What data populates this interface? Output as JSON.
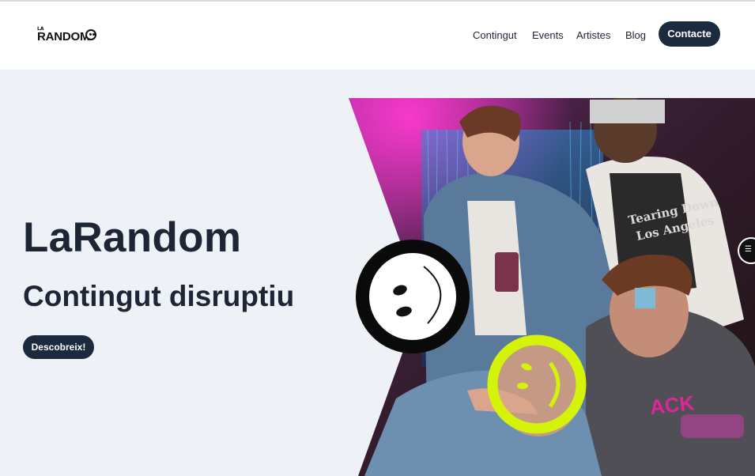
{
  "header": {
    "logo": {
      "small": "LA",
      "word": "RANDOM"
    },
    "nav": [
      "Contingut",
      "Events",
      "Artistes",
      "Blog"
    ],
    "contact_label": "Contacte"
  },
  "hero": {
    "title": "LaRandom",
    "subtitle": "Contingut disruptiu",
    "cta_label": "Descobreix!"
  },
  "photo": {
    "shirt_text_1": "Tearing Down",
    "shirt_text_2": "Los Angeles",
    "hoodie_text": "ACK"
  },
  "colors": {
    "navy": "#1c2a3d",
    "background": "#eef2f7",
    "smiley_lime": "#d4f20a",
    "accent_pink": "#e0249a"
  },
  "icons": [
    "smiley-icon",
    "smiley-lime-icon",
    "menu-widget-icon"
  ]
}
